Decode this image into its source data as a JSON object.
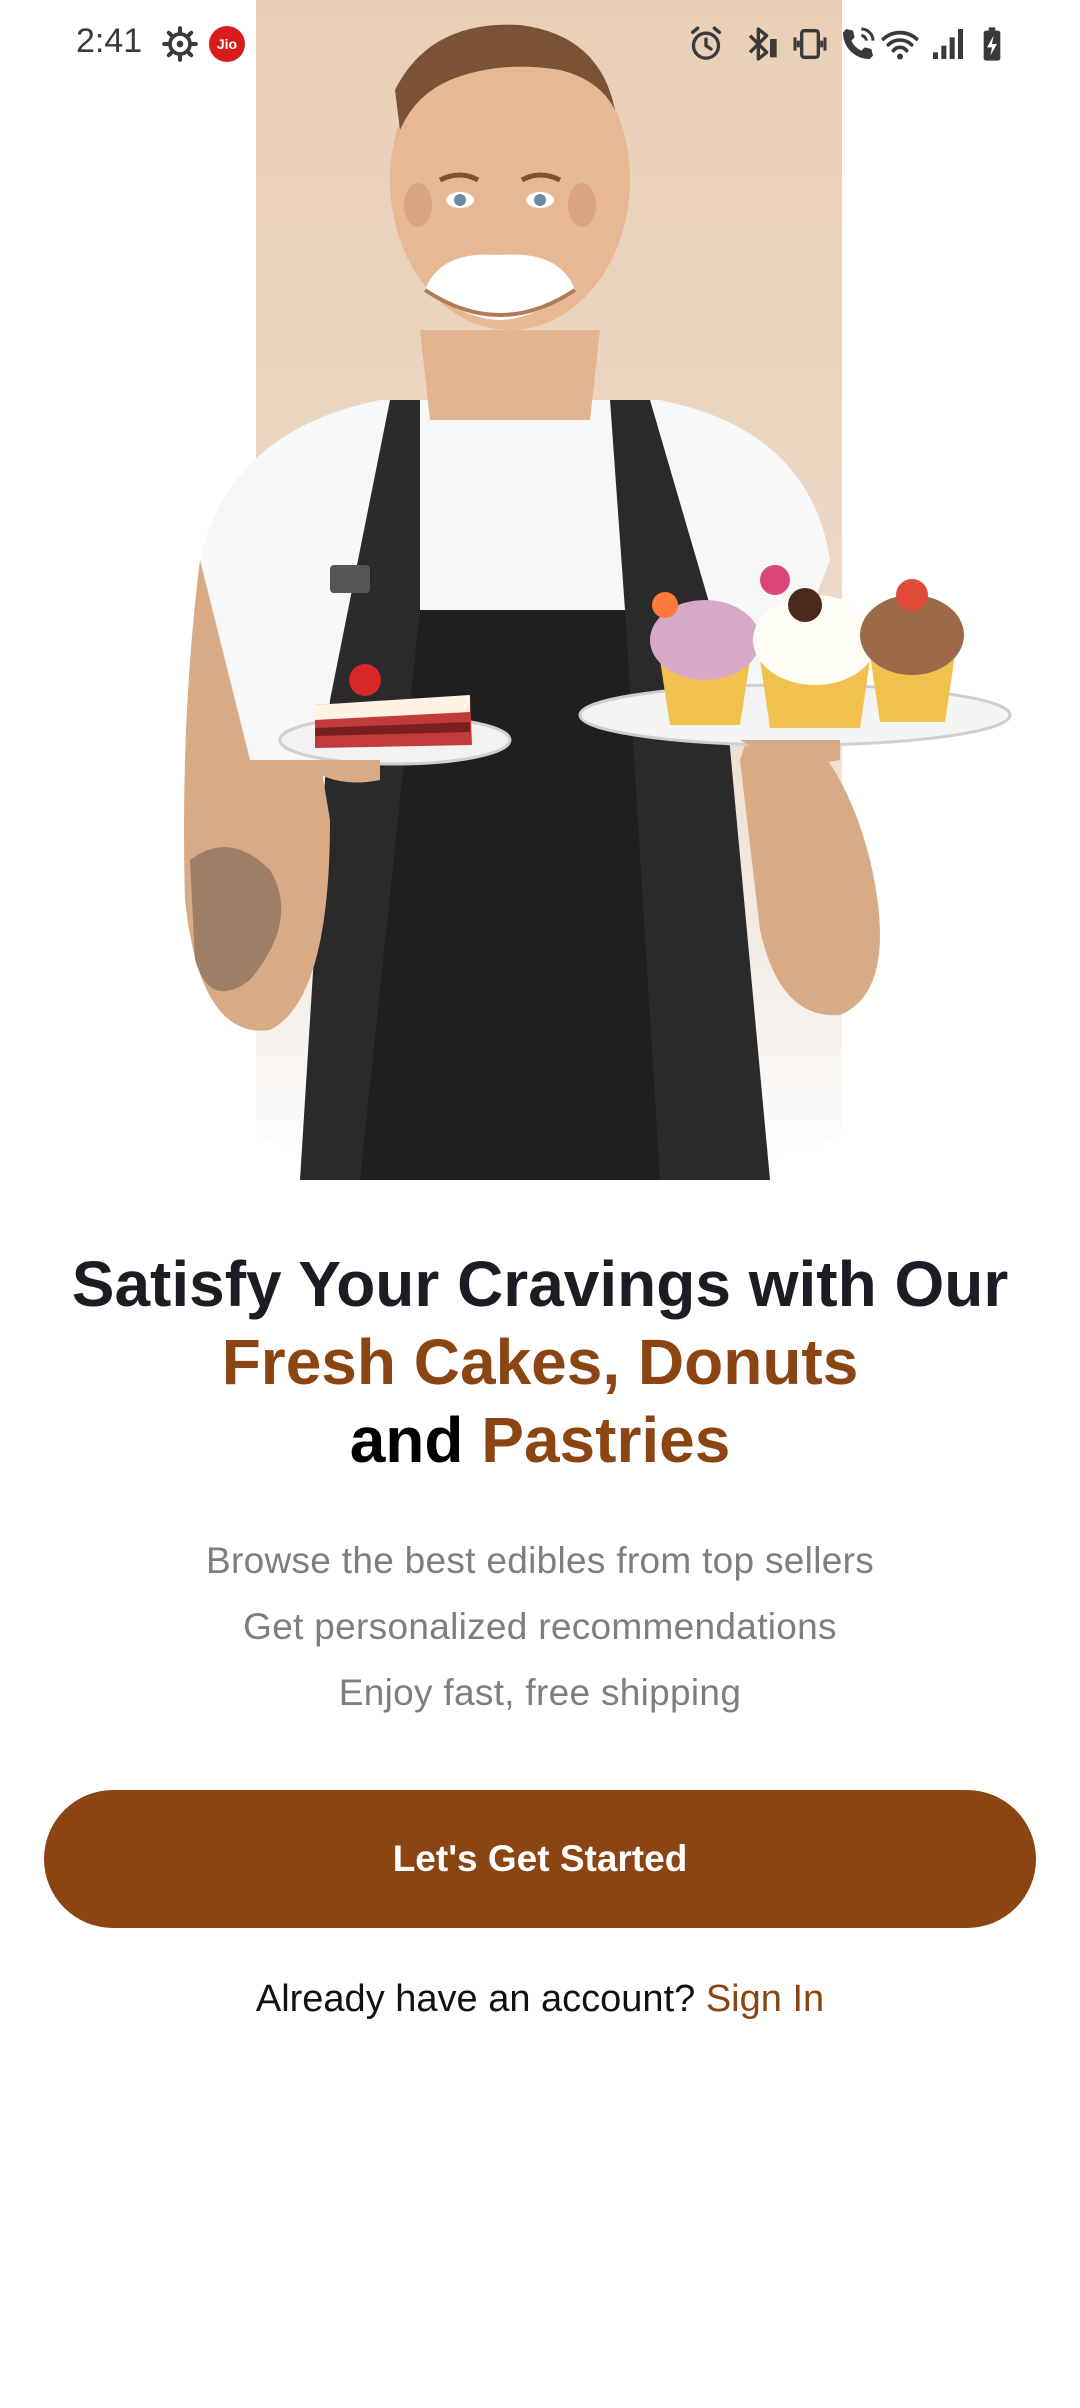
{
  "status_bar": {
    "time": "2:41",
    "carrier_badge": "Jio",
    "icons": [
      "settings-icon",
      "jio-icon",
      "alarm-icon",
      "bluetooth-icon",
      "vibrate-icon",
      "wifi-calling-icon",
      "wifi-icon",
      "signal-icon",
      "battery-charging-icon"
    ]
  },
  "hero": {
    "image_description_icon": "baker-holding-cakes-photo"
  },
  "headline": {
    "line1": "Satisfy Your Cravings with Our",
    "line2": "Fresh Cakes, Donuts",
    "line3_and": "and",
    "line3_accent": "Pastries"
  },
  "bullets": [
    "Browse the best edibles from top sellers",
    "Get personalized recommendations",
    "Enjoy fast, free shipping"
  ],
  "cta": {
    "label": "Let's Get Started"
  },
  "signin": {
    "prompt": "Already have an account?",
    "link": "Sign In"
  },
  "colors": {
    "accent": "#8b4513",
    "headline": "#1c1c24",
    "muted": "#7e7e7e",
    "panel": "#e9cfb6"
  }
}
